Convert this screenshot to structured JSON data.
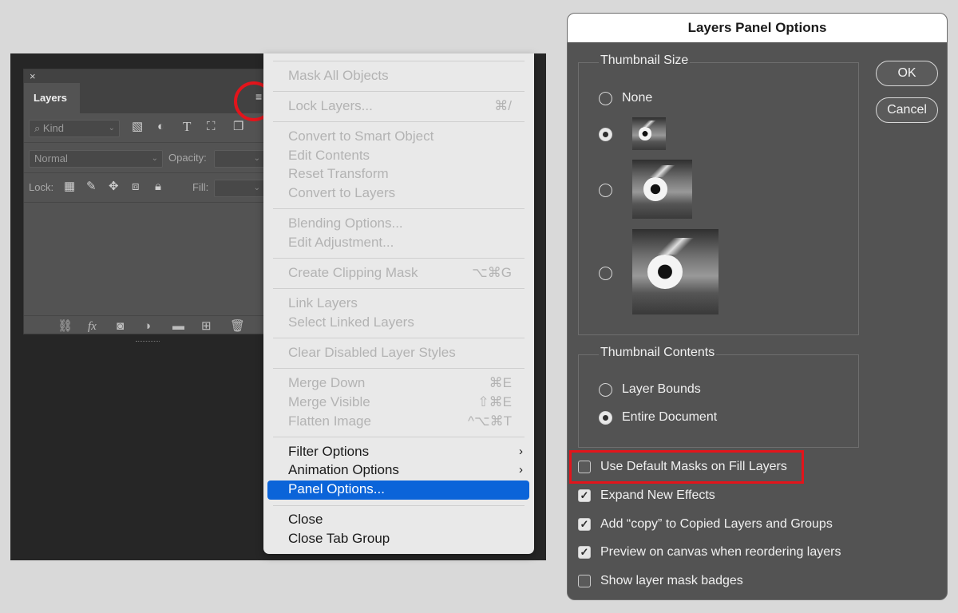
{
  "layers_panel": {
    "tab_label": "Layers",
    "close_glyph": "×",
    "collapse_glyph": "‹‹",
    "kind_label": "Kind",
    "blend_mode": "Normal",
    "opacity_label": "Opacity:",
    "lock_label": "Lock:",
    "fill_label": "Fill:"
  },
  "panel_menu": {
    "items": [
      {
        "label": "Mask All Objects",
        "shortcut": "",
        "enabled": false
      },
      {
        "label": "Lock Layers...",
        "shortcut": "⌘/",
        "enabled": false
      },
      {
        "label": "Convert to Smart Object",
        "shortcut": "",
        "enabled": false
      },
      {
        "label": "Edit Contents",
        "shortcut": "",
        "enabled": false
      },
      {
        "label": "Reset Transform",
        "shortcut": "",
        "enabled": false
      },
      {
        "label": "Convert to Layers",
        "shortcut": "",
        "enabled": false
      },
      {
        "label": "Blending Options...",
        "shortcut": "",
        "enabled": false
      },
      {
        "label": "Edit Adjustment...",
        "shortcut": "",
        "enabled": false
      },
      {
        "label": "Create Clipping Mask",
        "shortcut": "⌥⌘G",
        "enabled": false
      },
      {
        "label": "Link Layers",
        "shortcut": "",
        "enabled": false
      },
      {
        "label": "Select Linked Layers",
        "shortcut": "",
        "enabled": false
      },
      {
        "label": "Clear Disabled Layer Styles",
        "shortcut": "",
        "enabled": false
      },
      {
        "label": "Merge Down",
        "shortcut": "⌘E",
        "enabled": false
      },
      {
        "label": "Merge Visible",
        "shortcut": "⇧⌘E",
        "enabled": false
      },
      {
        "label": "Flatten Image",
        "shortcut": "^⌥⌘T",
        "enabled": false
      },
      {
        "label": "Filter Options",
        "shortcut": "",
        "enabled": true
      },
      {
        "label": "Animation Options",
        "shortcut": "",
        "enabled": true
      },
      {
        "label": "Panel Options...",
        "shortcut": "",
        "enabled": true,
        "highlighted": true
      },
      {
        "label": "Close",
        "shortcut": "",
        "enabled": true
      },
      {
        "label": "Close Tab Group",
        "shortcut": "",
        "enabled": true
      }
    ]
  },
  "dialog": {
    "title": "Layers Panel Options",
    "ok_label": "OK",
    "cancel_label": "Cancel",
    "thumbnail_size_label": "Thumbnail Size",
    "thumbnail_size_options": [
      "None",
      "Small",
      "Medium",
      "Large"
    ],
    "thumbnail_size_selected": "Small",
    "thumbnail_size_none_label": "None",
    "thumbnail_contents_label": "Thumbnail Contents",
    "layer_bounds_label": "Layer Bounds",
    "entire_document_label": "Entire Document",
    "thumbnail_contents_selected": "Entire Document",
    "checkboxes": [
      {
        "label": "Use Default Masks on Fill Layers",
        "checked": false
      },
      {
        "label": "Expand New Effects",
        "checked": true
      },
      {
        "label": "Add “copy” to Copied Layers and Groups",
        "checked": true
      },
      {
        "label": "Preview on canvas when reordering layers",
        "checked": true
      },
      {
        "label": "Show layer mask badges",
        "checked": false
      }
    ]
  },
  "colors": {
    "highlight": "#0b64d9",
    "annotation_red": "#e3141b"
  }
}
